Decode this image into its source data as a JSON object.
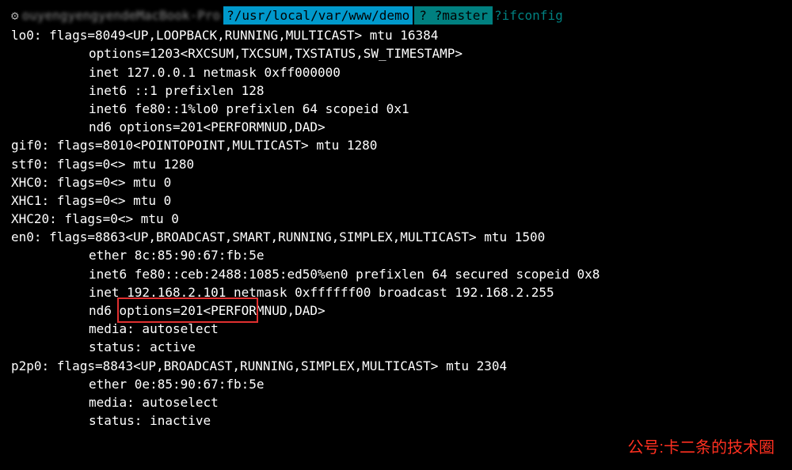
{
  "prompt": {
    "gear": "⚙",
    "user_host": "ouyengyengyendeMacBook-Pro",
    "path_prefix": "?",
    "path": "/usr/local/var/www/demo",
    "branch_prefix": "? ?",
    "branch": "master",
    "cmd_prefix": "?",
    "command": "ifconfig"
  },
  "output": {
    "lo0": {
      "header": "lo0: flags=8049<UP,LOOPBACK,RUNNING,MULTICAST> mtu 16384",
      "lines": [
        "options=1203<RXCSUM,TXCSUM,TXSTATUS,SW_TIMESTAMP>",
        "inet 127.0.0.1 netmask 0xff000000",
        "inet6 ::1 prefixlen 128",
        "inet6 fe80::1%lo0 prefixlen 64 scopeid 0x1",
        "nd6 options=201<PERFORMNUD,DAD>"
      ]
    },
    "gif0": "gif0: flags=8010<POINTOPOINT,MULTICAST> mtu 1280",
    "stf0": "stf0: flags=0<> mtu 1280",
    "xhc0": "XHC0: flags=0<> mtu 0",
    "xhc1": "XHC1: flags=0<> mtu 0",
    "xhc20": "XHC20: flags=0<> mtu 0",
    "en0": {
      "header": "en0: flags=8863<UP,BROADCAST,SMART,RUNNING,SIMPLEX,MULTICAST> mtu 1500",
      "lines": [
        "ether 8c:85:90:67:fb:5e",
        "inet6 fe80::ceb:2488:1085:ed50%en0 prefixlen 64 secured scopeid 0x8",
        "inet 192.168.2.101 netmask 0xffffff00 broadcast 192.168.2.255",
        "nd6 options=201<PERFORMNUD,DAD>",
        "media: autoselect",
        "status: active"
      ]
    },
    "p2p0": {
      "header": "p2p0: flags=8843<UP,BROADCAST,RUNNING,SIMPLEX,MULTICAST> mtu 2304",
      "lines": [
        "ether 0e:85:90:67:fb:5e",
        "media: autoselect",
        "status: inactive"
      ]
    }
  },
  "highlight": {
    "ip": "192.168.2.101"
  },
  "watermark": "公号:卡二条的技术圈"
}
